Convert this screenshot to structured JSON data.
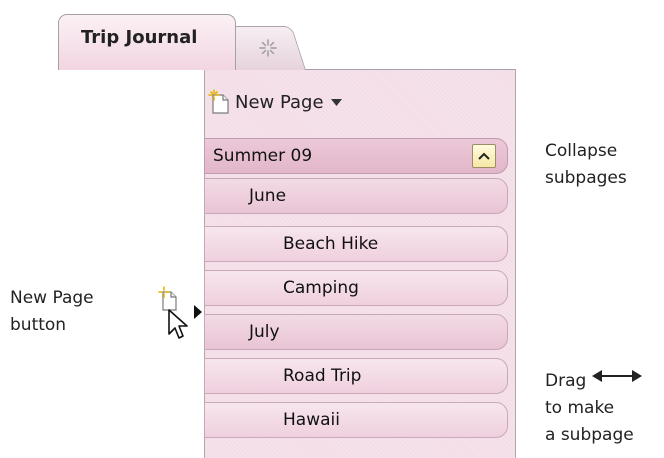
{
  "tabs": {
    "active": {
      "label": "Trip Journal"
    },
    "new_tab": {
      "icon": "sparkle-icon"
    }
  },
  "new_page_button": {
    "label": "New Page",
    "icon": "new-page-icon",
    "dropdown_icon": "caret-down-icon"
  },
  "pages": [
    {
      "label": "Summer 09",
      "level": 0,
      "state": "selected",
      "collapse_icon": "chevron-up-icon"
    },
    {
      "label": "June",
      "level": 1,
      "state": "parent"
    },
    {
      "label": "Beach Hike",
      "level": 2,
      "state": "normal"
    },
    {
      "label": "Camping",
      "level": 2,
      "state": "normal"
    },
    {
      "label": "July",
      "level": 1,
      "state": "parent"
    },
    {
      "label": "Road Trip",
      "level": 2,
      "state": "normal"
    },
    {
      "label": "Hawaii",
      "level": 2,
      "state": "normal"
    }
  ],
  "annotations": {
    "collapse": [
      "Collapse",
      "subpages"
    ],
    "new_page": [
      "New Page",
      "button"
    ],
    "drag": [
      "Drag",
      "to make",
      "a subpage"
    ],
    "drag_icon": "double-arrow-icon"
  },
  "colors": {
    "panel": "#f3dde7",
    "row": "#efd0de",
    "selected_row": "#e2b6ca",
    "collapse_button": "#f7e7a6",
    "border": "#a7a0a8"
  }
}
